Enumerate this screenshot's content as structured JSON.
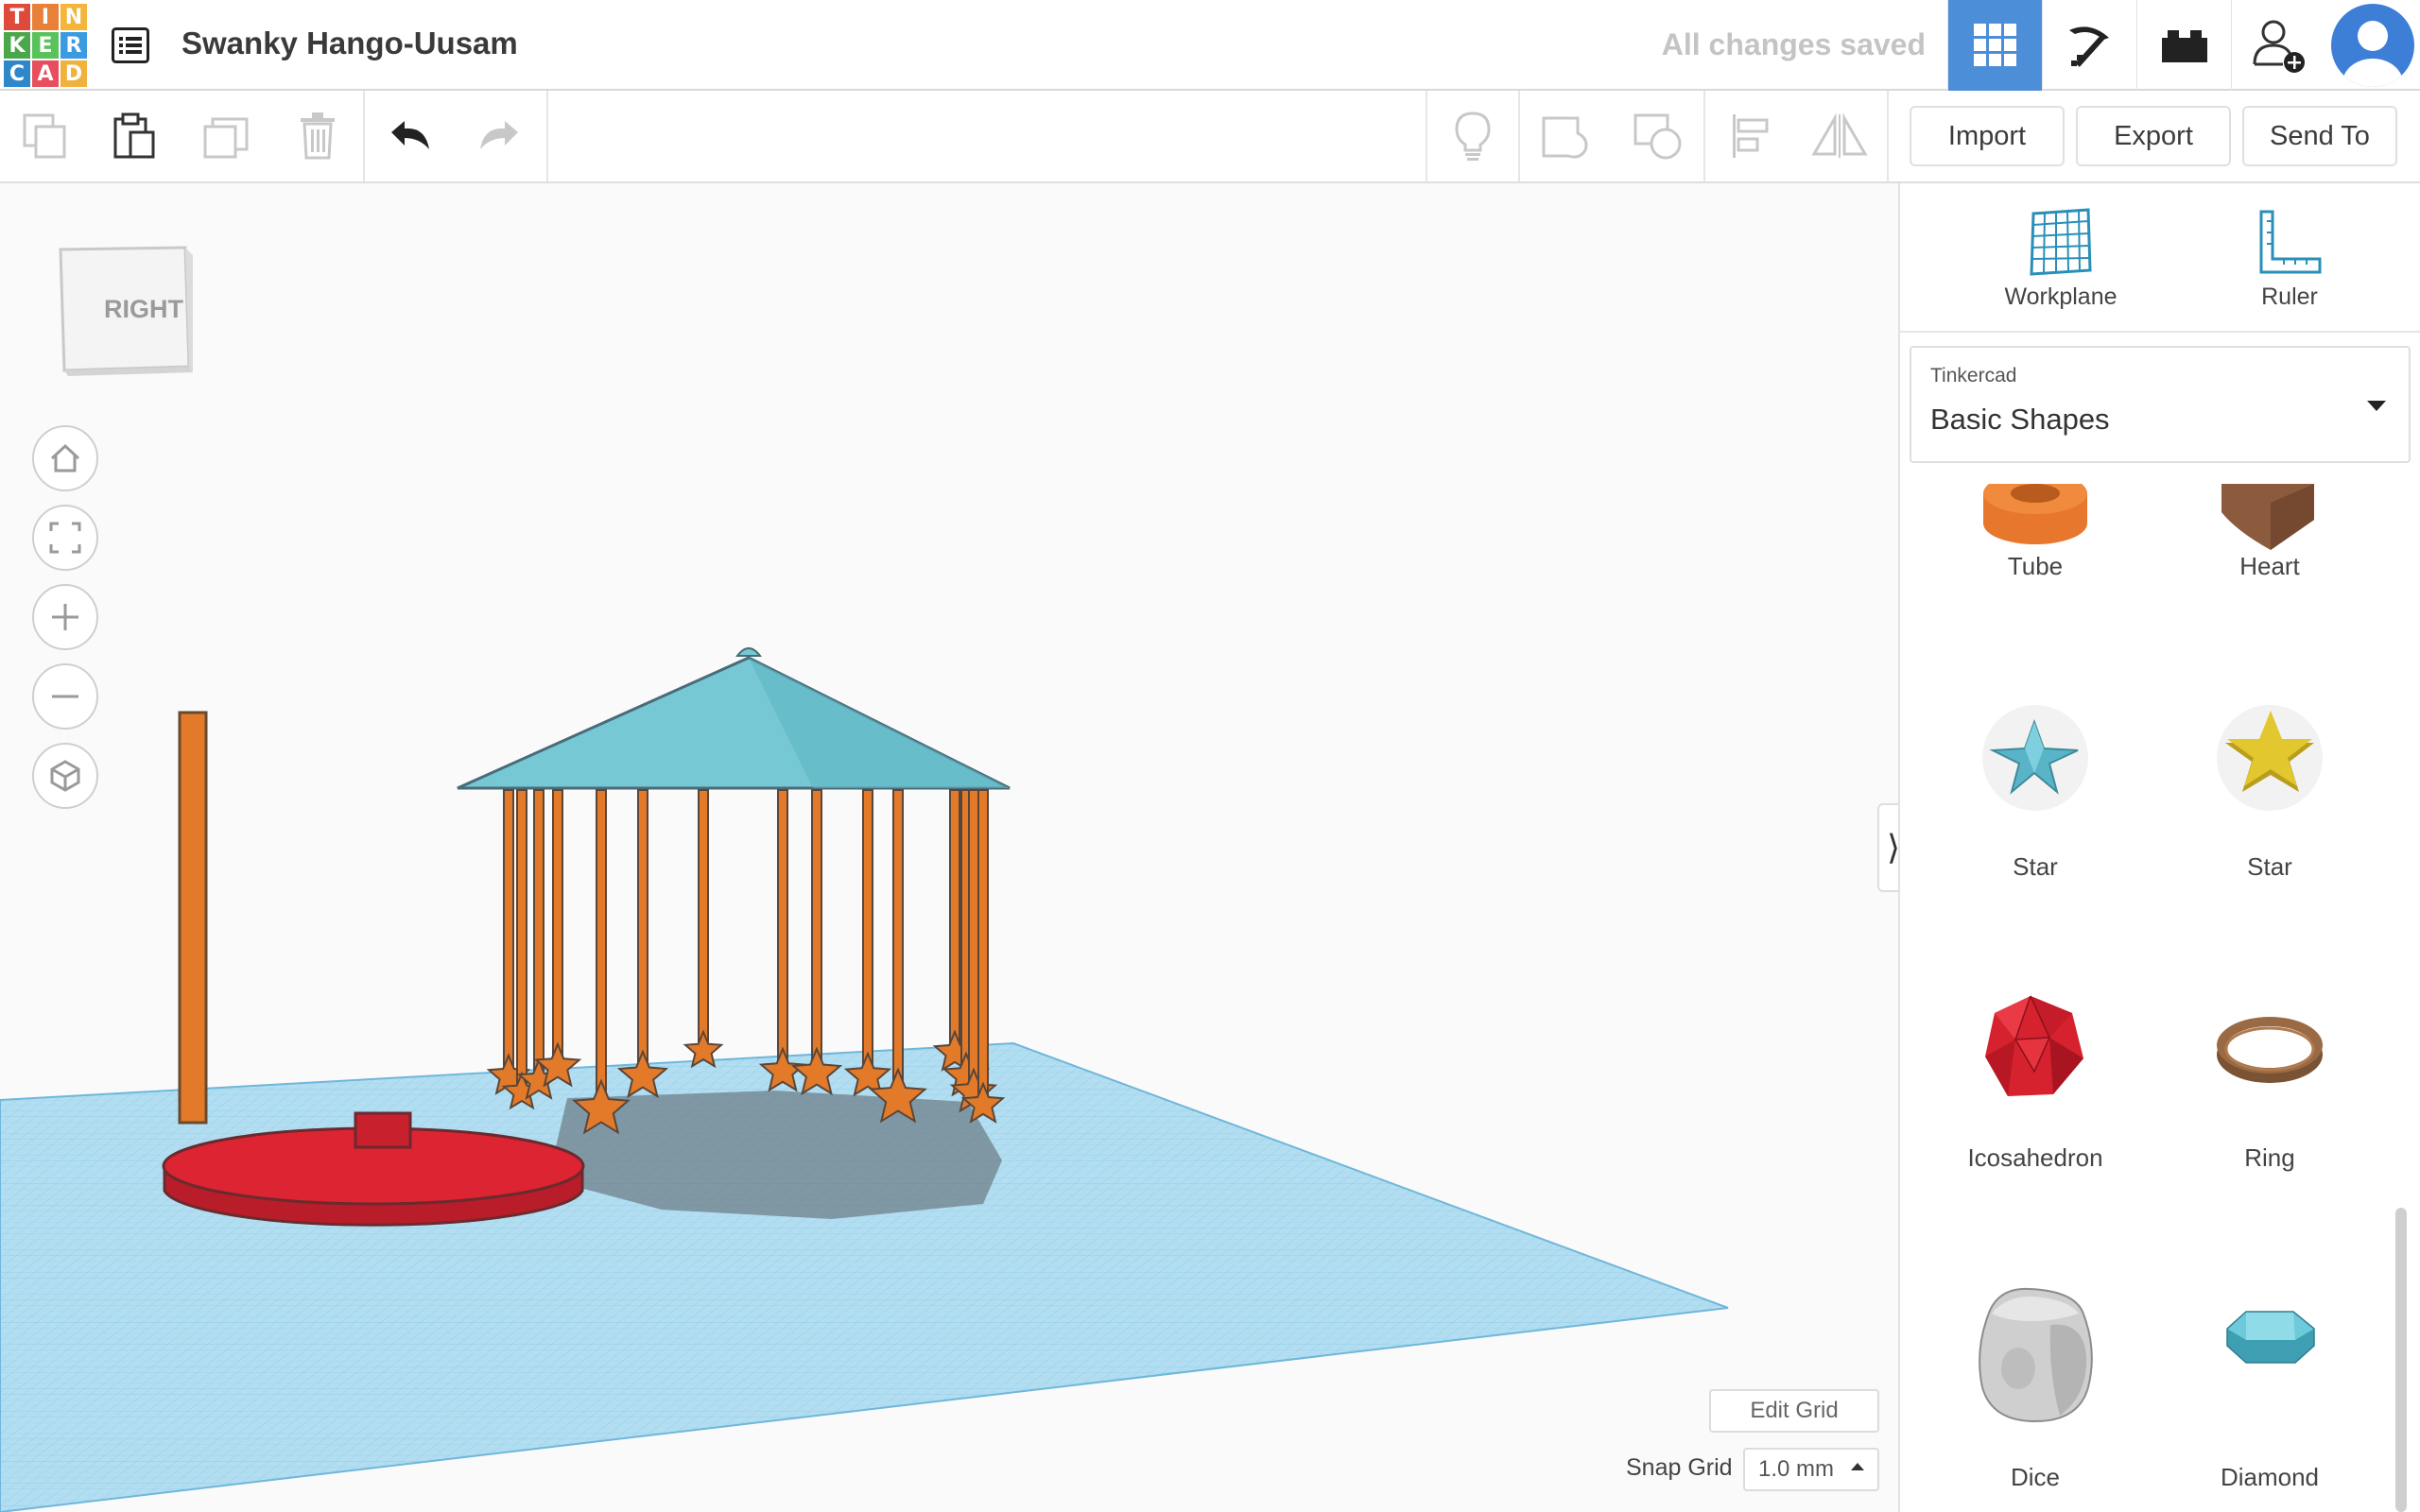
{
  "app": {
    "logo_letters": [
      "T",
      "I",
      "N",
      "K",
      "E",
      "R",
      "C",
      "A",
      "D"
    ],
    "logo_colors": [
      "#e04a3b",
      "#e8803a",
      "#f3b53a",
      "#4ba84a",
      "#5ac25a",
      "#3a9be0",
      "#2f86c9",
      "#e84e5d",
      "#f1b23d"
    ],
    "project_title": "Swanky Hango-Uusam",
    "save_status": "All changes saved"
  },
  "topbar_icons": [
    "grid-view-icon",
    "pickaxe-icon",
    "brick-icon",
    "add-user-icon",
    "user-avatar-icon"
  ],
  "toolbar": {
    "left_tools": [
      "copy-icon",
      "paste-icon",
      "duplicate-icon",
      "delete-icon",
      "undo-icon",
      "redo-icon"
    ],
    "right_tools": [
      "light-bulb-icon",
      "group-icon",
      "ungroup-icon",
      "align-icon",
      "mirror-icon"
    ],
    "import_label": "Import",
    "export_label": "Export",
    "send_to_label": "Send To"
  },
  "viewcube": {
    "face_label": "RIGHT"
  },
  "nav_buttons": [
    "home-view-icon",
    "fit-view-icon",
    "zoom-in-icon",
    "zoom-out-icon",
    "perspective-icon"
  ],
  "workspace": {
    "edit_grid_label": "Edit Grid",
    "snap_grid_label": "Snap Grid",
    "snap_grid_value": "1.0 mm",
    "colors": {
      "workplane": "#a7d8ee",
      "grid_line": "#7cc0e0",
      "roof": "#75c8d4",
      "hanger": "#e27a2a",
      "base": "#dc2432",
      "shadow": "#6f7f89"
    }
  },
  "panel": {
    "workplane_label": "Workplane",
    "ruler_label": "Ruler",
    "library_source": "Tinkercad",
    "library_name": "Basic Shapes",
    "shapes": [
      {
        "label": "Tube",
        "icon": "tube-icon",
        "color": "#e8772e"
      },
      {
        "label": "Heart",
        "icon": "heart-icon",
        "color": "#8c5a3c"
      },
      {
        "label": "Star",
        "icon": "star-3d-icon",
        "color": "#5ab4c8"
      },
      {
        "label": "Star",
        "icon": "star-icon",
        "color": "#e3c72e"
      },
      {
        "label": "Icosahedron",
        "icon": "icosahedron-icon",
        "color": "#d6222f"
      },
      {
        "label": "Ring",
        "icon": "ring-icon",
        "color": "#9a6a44"
      },
      {
        "label": "Dice",
        "icon": "dice-icon",
        "color": "#c8c8c8"
      },
      {
        "label": "Diamond",
        "icon": "diamond-icon",
        "color": "#4fb5c8"
      }
    ]
  }
}
